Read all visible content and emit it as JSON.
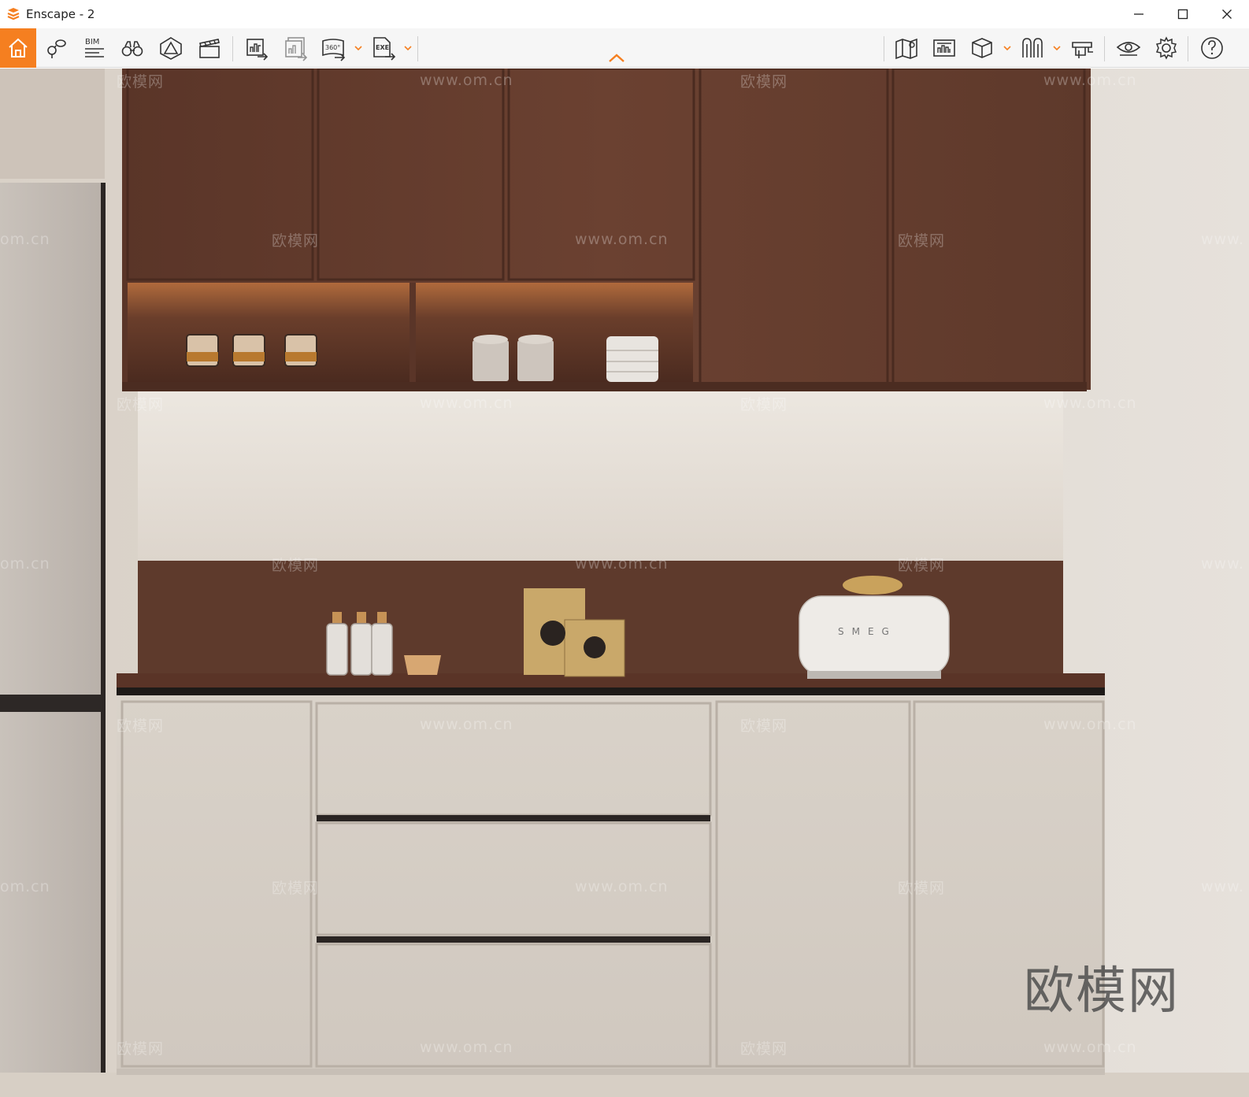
{
  "window": {
    "title": "Enscape - 2",
    "controls": [
      "minimize",
      "maximize",
      "close"
    ]
  },
  "toolbar": {
    "left_icons": [
      {
        "name": "home-icon",
        "active": true
      },
      {
        "name": "map-pin-icon"
      },
      {
        "name": "bim-icon",
        "label": "BIM"
      },
      {
        "name": "binoculars-icon"
      },
      {
        "name": "section-cut-icon"
      },
      {
        "name": "clapperboard-icon"
      },
      {
        "name": "export-image-icon"
      },
      {
        "name": "batch-render-icon"
      },
      {
        "name": "export-360-icon",
        "label": "360°"
      },
      {
        "name": "export-exe-icon",
        "label": "EXE"
      }
    ],
    "right_icons": [
      {
        "name": "map-view-icon"
      },
      {
        "name": "image-gallery-icon"
      },
      {
        "name": "cube-view-icon"
      },
      {
        "name": "asset-library-icon"
      },
      {
        "name": "material-editor-icon"
      },
      {
        "name": "visibility-icon"
      },
      {
        "name": "settings-gear-icon"
      },
      {
        "name": "help-icon"
      }
    ],
    "accent_color": "#f57f20",
    "collapse": "chevron-up-icon"
  },
  "viewport": {
    "watermark_url": "www.om.cn",
    "watermark_cn": "欧模网",
    "watermark_partial_left": "om.cn",
    "watermark_partial_right": "www.",
    "brand_watermark": "欧模网",
    "toaster_brand": "SMEG"
  }
}
